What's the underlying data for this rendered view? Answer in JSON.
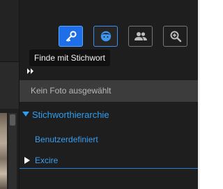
{
  "toolbar": {
    "buttons": [
      {
        "icon": "key-icon",
        "state": "active"
      },
      {
        "icon": "face-icon",
        "state": "hover"
      },
      {
        "icon": "people-icon",
        "state": "normal"
      },
      {
        "icon": "zoom-in-icon",
        "state": "normal"
      }
    ],
    "tooltip": "Finde mit Stichwort"
  },
  "panel": {
    "status": "Kein Foto ausgewählt",
    "section_title": "Stichworthierarchie",
    "items": [
      {
        "label": "Benutzerdefiniert"
      },
      {
        "label": "Excire",
        "expandable": true
      }
    ]
  },
  "colors": {
    "accent": "#2f9ff2",
    "active_button": "#1d6ee8",
    "background": "#1e1e1e",
    "status_bar": "#3c3c3c"
  }
}
